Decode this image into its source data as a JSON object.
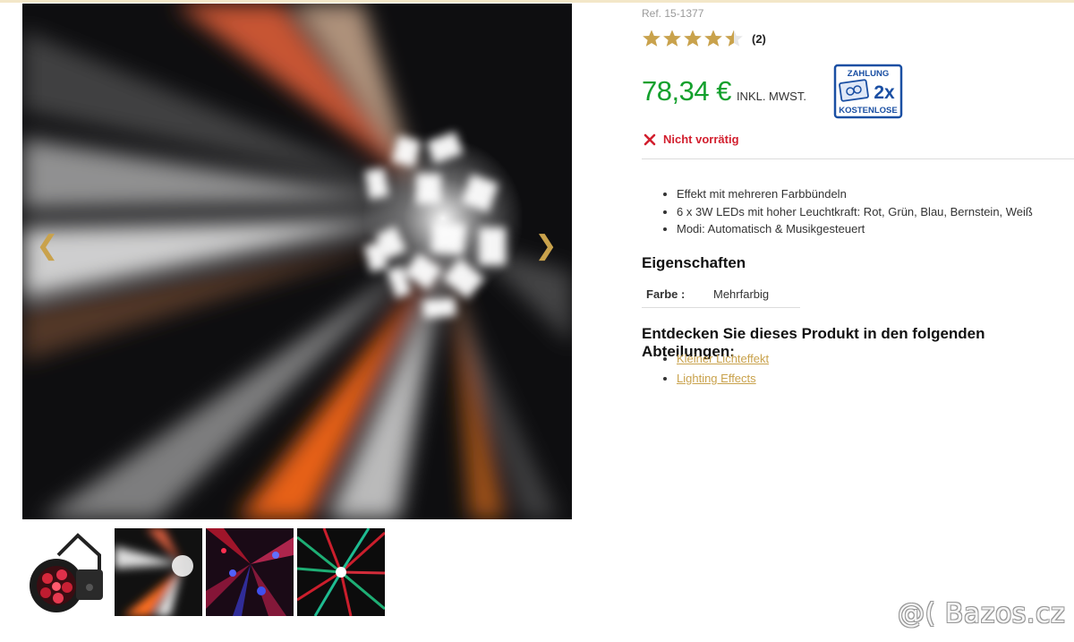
{
  "product": {
    "ref": "Ref. 15-1377",
    "rating_value": 4.5,
    "rating_max": 5,
    "rating_count": "(2)",
    "price": "78,34 €",
    "vat_label": "INKL. MWST.",
    "stock_status": "Nicht vorrätig",
    "features": [
      "Effekt mit mehreren Farbbündeln",
      "6 x 3W LEDs mit hoher Leuchtkraft: Rot, Grün, Blau, Bernstein, Weiß",
      "Modi: Automatisch & Musikgesteuert"
    ]
  },
  "payment_badge": {
    "top": "ZAHLUNG",
    "middle": "2x",
    "bottom": "KOSTENLOSE",
    "color": "#1a4fa3"
  },
  "properties": {
    "title": "Eigenschaften",
    "rows": [
      {
        "key": "Farbe :",
        "value": "Mehrfarbig"
      }
    ]
  },
  "departments": {
    "title": "Entdecken Sie dieses Produkt in den folgenden Abteilungen:",
    "links": [
      "Kleiner Lichteffekt",
      "Lighting Effects"
    ]
  },
  "gallery": {
    "prev_icon": "chevron-left-icon",
    "next_icon": "chevron-right-icon",
    "thumbnails": [
      "product-device-thumbnail",
      "white-orange-beams-thumbnail",
      "red-blue-beams-thumbnail",
      "green-red-beams-thumbnail"
    ]
  },
  "watermark": "@( Bazos.cz",
  "colors": {
    "price": "#14a02d",
    "stock": "#d21f2e",
    "star": "#c9a24c",
    "link": "#c9a24c"
  }
}
